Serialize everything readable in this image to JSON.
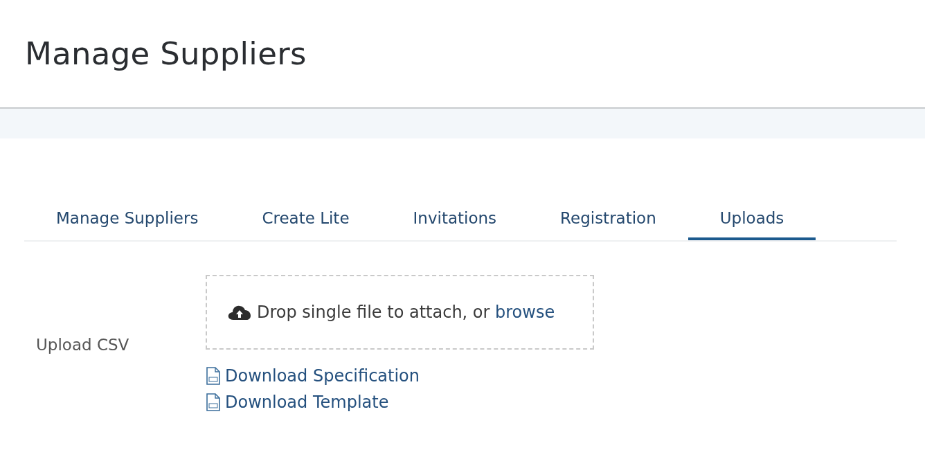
{
  "page": {
    "title": "Manage Suppliers"
  },
  "tabs": [
    {
      "label": "Manage Suppliers",
      "selected": false
    },
    {
      "label": "Create Lite",
      "selected": false
    },
    {
      "label": "Invitations",
      "selected": false
    },
    {
      "label": "Registration",
      "selected": false
    },
    {
      "label": "Uploads",
      "selected": true
    }
  ],
  "upload": {
    "label": "Upload CSV",
    "drop_text": "Drop single file to attach, or ",
    "browse_link": "browse",
    "links": [
      {
        "label": "Download Specification"
      },
      {
        "label": "Download Template"
      }
    ]
  }
}
